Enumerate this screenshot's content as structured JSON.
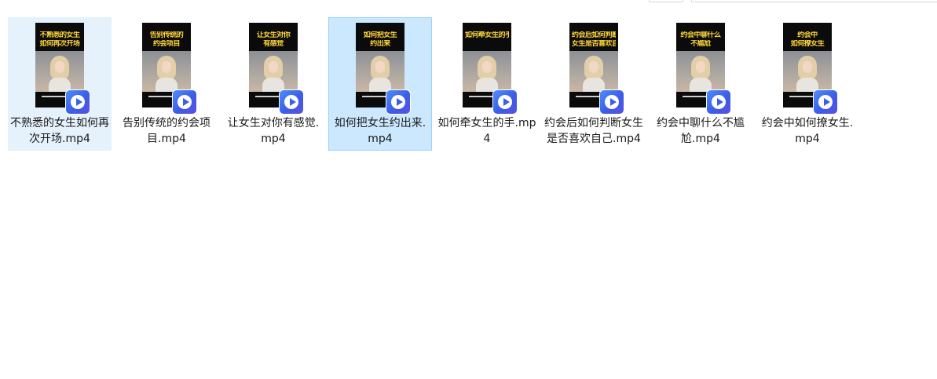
{
  "files": [
    {
      "name": "不熟悉的女生如何再次开场.mp4",
      "thumb_title": [
        "不熟悉的女生",
        "如何再次开场"
      ],
      "state": "hover"
    },
    {
      "name": "告别传统的约会项目.mp4",
      "thumb_title": [
        "告别传统的",
        "约会项目"
      ],
      "state": "normal"
    },
    {
      "name": "让女生对你有感觉.mp4",
      "thumb_title": [
        "让女生对你",
        "有感觉"
      ],
      "state": "normal"
    },
    {
      "name": "如何把女生约出来.mp4",
      "thumb_title": [
        "如何把女生",
        "约出来"
      ],
      "state": "selected"
    },
    {
      "name": "如何牵女生的手.mp4",
      "thumb_title": [
        "如何牵女生的手",
        ""
      ],
      "state": "normal"
    },
    {
      "name": "约会后如何判断女生是否喜欢自己.mp4",
      "thumb_title": [
        "约会后如何判断",
        "女生是否喜欢自己"
      ],
      "state": "normal"
    },
    {
      "name": "约会中聊什么不尴尬.mp4",
      "thumb_title": [
        "约会中聊什么",
        "不尴尬"
      ],
      "state": "normal"
    },
    {
      "name": "约会中如何撩女生.mp4",
      "thumb_title": [
        "约会中",
        "如何撩女生"
      ],
      "state": "normal"
    }
  ],
  "icons": {
    "file_type_badge": "video-player-icon",
    "badge_colors": [
      "#4f8dfb",
      "#3b5de8",
      "#5b4fe0"
    ]
  },
  "colors": {
    "hover_bg": "#e5f1fb",
    "selected_bg": "#cce8ff",
    "selected_border": "#99d1ff",
    "thumb_title": "#ffd63a"
  }
}
